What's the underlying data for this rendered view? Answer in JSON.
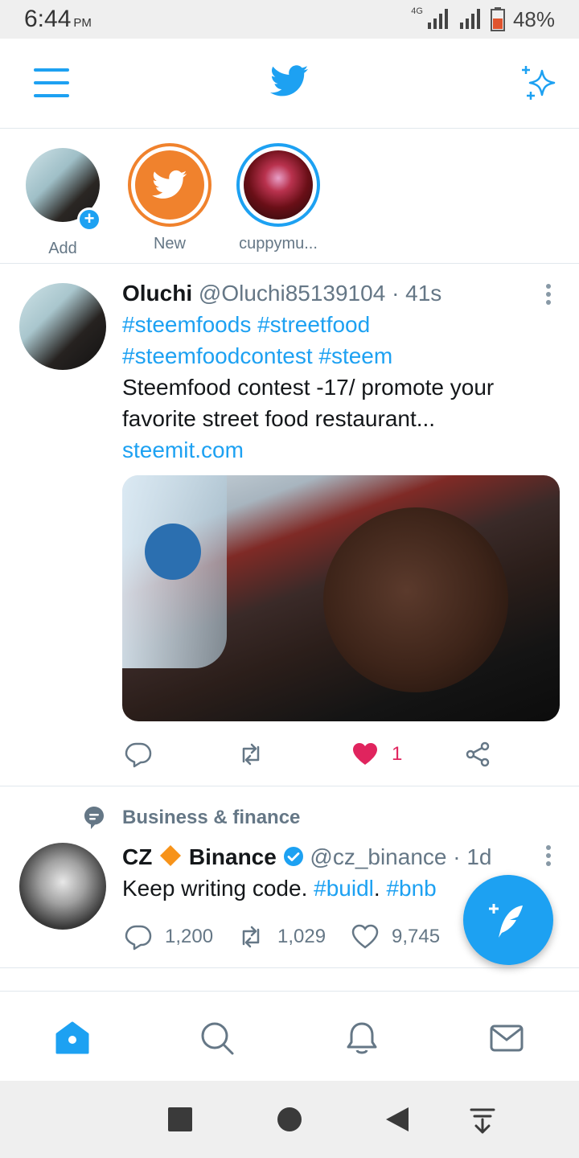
{
  "status_bar": {
    "time": "6:44",
    "ampm": "PM",
    "network": "4G",
    "battery_percent": "48%"
  },
  "header": {
    "icons": [
      "menu-icon",
      "twitter-bird-icon",
      "sparkle-icon"
    ],
    "accent_color": "#1da1f2"
  },
  "fleets": [
    {
      "label": "Add"
    },
    {
      "label": "New"
    },
    {
      "label": "cuppymu..."
    }
  ],
  "tweets": [
    {
      "name": "Oluchi",
      "handle": "@Oluchi85139104",
      "time": "· 41s",
      "hashtags_line1": "#steemfoods #streetfood",
      "hashtags_line2": "#steemfoodcontest #steem",
      "text": "Steemfood contest -17/ promote your favorite street food restaurant...",
      "link": "steemit.com",
      "reply_count": "",
      "retweet_count": "",
      "like_count": "1",
      "liked": true
    },
    {
      "topic": "Business & finance",
      "name_part1": "CZ",
      "name_part2": "Binance",
      "handle": "@cz_binance",
      "time": "· 1d",
      "text_plain": "Keep writing code. ",
      "hashtag1": "#buidl",
      "text_dot": ". ",
      "hashtag2": "#bnb",
      "reply_count": "1,200",
      "retweet_count": "1,029",
      "like_count": "9,745"
    }
  ],
  "bottom_nav": [
    "home-icon",
    "search-icon",
    "notifications-icon",
    "messages-icon"
  ],
  "like_color": "#e0245e"
}
